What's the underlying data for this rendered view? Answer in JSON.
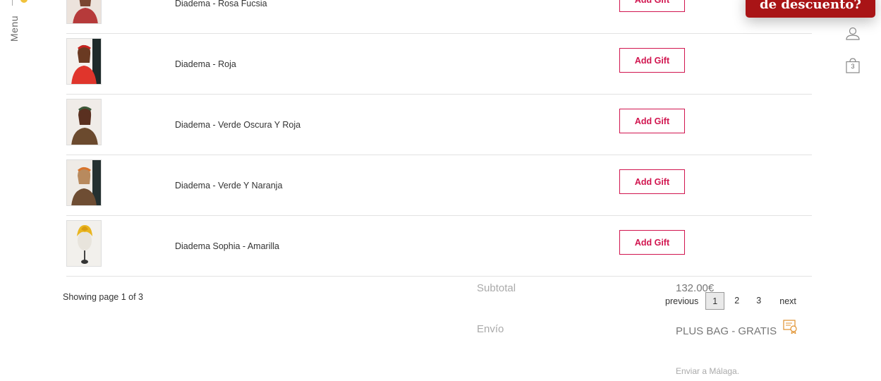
{
  "sidebar": {
    "menu_label": "Menu"
  },
  "header": {
    "promo_label": "de descuento?",
    "bag_count": "3",
    "accent_color": "#a91416"
  },
  "gift_list": {
    "button_color": "#d1154f",
    "items": [
      {
        "name": "Diadema - Rosa Fucsia",
        "button": "Add Gift"
      },
      {
        "name": "Diadema - Roja",
        "button": "Add Gift"
      },
      {
        "name": "Diadema - Verde Oscura Y Roja",
        "button": "Add Gift"
      },
      {
        "name": "Diadema - Verde Y Naranja",
        "button": "Add Gift"
      },
      {
        "name": "Diadema Sophia - Amarilla",
        "button": "Add Gift"
      }
    ]
  },
  "pagination": {
    "showing": "Showing page 1 of 3",
    "previous": "previous",
    "pages": [
      "1",
      "2",
      "3"
    ],
    "current": "1",
    "next": "next"
  },
  "totals": {
    "subtotal_label": "Subtotal",
    "subtotal_value": "132.00€",
    "shipping_label": "Envío",
    "shipping_value": "PLUS BAG - GRATIS",
    "shipping_note": "Enviar a Málaga."
  }
}
